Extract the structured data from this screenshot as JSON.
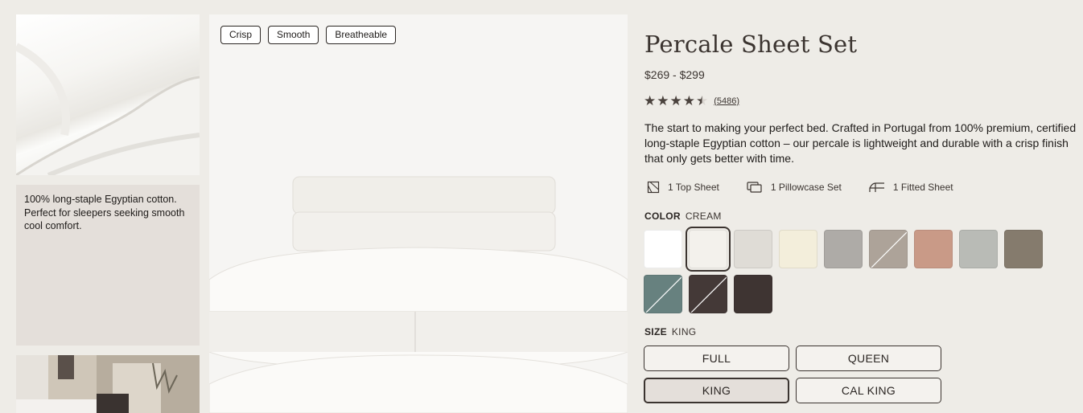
{
  "gallery": {
    "note": "100% long-staple Egyptian cotton. Perfect for sleepers seeking smooth cool comfort."
  },
  "main_image": {
    "tags": [
      "Crisp",
      "Smooth",
      "Breatheable"
    ]
  },
  "product": {
    "title": "Percale Sheet Set",
    "price": "$269 - $299",
    "rating": 4.5,
    "review_count": "(5486)",
    "description": "The start to making your perfect bed. Crafted in Portugal from 100% premium, certified long-staple Egyptian cotton – our percale is lightweight and durable with a crisp finish that only gets better with time.",
    "includes": [
      {
        "icon": "top-sheet-icon",
        "label": "1 Top Sheet"
      },
      {
        "icon": "pillowcase-icon",
        "label": "1 Pillowcase Set"
      },
      {
        "icon": "fitted-sheet-icon",
        "label": "1 Fitted Sheet"
      }
    ]
  },
  "color": {
    "label": "COLOR",
    "selected": "CREAM",
    "swatches": [
      {
        "color": "#ffffff",
        "slash": false,
        "selected": false
      },
      {
        "color": "#f3f1ec",
        "slash": false,
        "selected": true
      },
      {
        "color": "#dfdcd6",
        "slash": false,
        "selected": false
      },
      {
        "color": "#f3eedb",
        "slash": false,
        "selected": false
      },
      {
        "color": "#aeaba7",
        "slash": false,
        "selected": false
      },
      {
        "color": "#ada399",
        "slash": true,
        "selected": false
      },
      {
        "color": "#c99a87",
        "slash": false,
        "selected": false
      },
      {
        "color": "#b9bbb6",
        "slash": false,
        "selected": false
      },
      {
        "color": "#857b6d",
        "slash": false,
        "selected": false
      },
      {
        "color": "#67817f",
        "slash": true,
        "selected": false
      },
      {
        "color": "#443937",
        "slash": true,
        "selected": false
      },
      {
        "color": "#3e3432",
        "slash": false,
        "selected": false
      }
    ]
  },
  "size": {
    "label": "SIZE",
    "selected": "KING",
    "options": [
      "FULL",
      "QUEEN",
      "KING",
      "CAL KING"
    ]
  }
}
